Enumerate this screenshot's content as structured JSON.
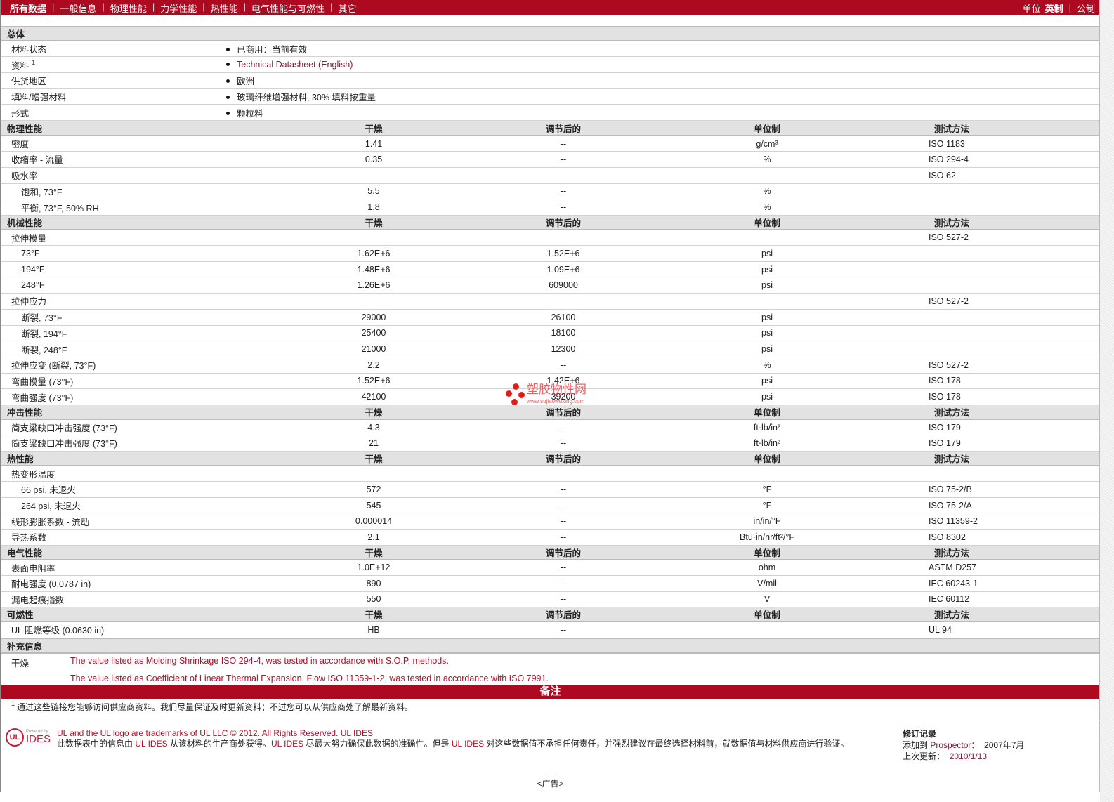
{
  "nav": {
    "active": "所有数据",
    "links": [
      "一般信息",
      "物理性能",
      "力学性能",
      "热性能",
      "电气性能与可燃性",
      "其它"
    ],
    "units_label": "单位",
    "unit_active": "英制",
    "unit_other": "公制"
  },
  "general": {
    "title": "总体",
    "rows": [
      {
        "label": "材料状态",
        "value": "已商用：当前有效"
      },
      {
        "label": "资料",
        "sup": "1",
        "value": "Technical Datasheet (English)",
        "link": true
      },
      {
        "label": "供货地区",
        "value": "欧洲"
      },
      {
        "label": "填料/增强材料",
        "value": "玻璃纤维增强材料, 30% 填料按重量"
      },
      {
        "label": "形式",
        "value": "颗粒料"
      }
    ]
  },
  "columns": {
    "dry": "干燥",
    "cond": "调节后的",
    "unit": "单位制",
    "method": "测试方法"
  },
  "sections": [
    {
      "title": "物理性能",
      "rows": [
        [
          "密度",
          0,
          "1.41",
          "--",
          "g/cm³",
          "ISO 1183"
        ],
        [
          "收缩率 - 流量",
          0,
          "0.35",
          "--",
          "%",
          "ISO 294-4"
        ],
        [
          "吸水率",
          0,
          "",
          "",
          "",
          "ISO 62"
        ],
        [
          "饱和, 73°F",
          1,
          "5.5",
          "--",
          "%",
          ""
        ],
        [
          "平衡, 73°F, 50% RH",
          1,
          "1.8",
          "--",
          "%",
          ""
        ]
      ]
    },
    {
      "title": "机械性能",
      "rows": [
        [
          "拉伸模量",
          0,
          "",
          "",
          "",
          "ISO 527-2"
        ],
        [
          "73°F",
          1,
          "1.62E+6",
          "1.52E+6",
          "psi",
          ""
        ],
        [
          "194°F",
          1,
          "1.48E+6",
          "1.09E+6",
          "psi",
          ""
        ],
        [
          "248°F",
          1,
          "1.26E+6",
          "609000",
          "psi",
          ""
        ],
        [
          "拉伸应力",
          0,
          "",
          "",
          "",
          "ISO 527-2"
        ],
        [
          "断裂, 73°F",
          1,
          "29000",
          "26100",
          "psi",
          ""
        ],
        [
          "断裂, 194°F",
          1,
          "25400",
          "18100",
          "psi",
          ""
        ],
        [
          "断裂, 248°F",
          1,
          "21000",
          "12300",
          "psi",
          ""
        ],
        [
          "拉伸应变 (断裂, 73°F)",
          0,
          "2.2",
          "--",
          "%",
          "ISO 527-2"
        ],
        [
          "弯曲模量 (73°F)",
          0,
          "1.52E+6",
          "1.42E+6",
          "psi",
          "ISO 178"
        ],
        [
          "弯曲强度 (73°F)",
          0,
          "42100",
          "39200",
          "psi",
          "ISO 178"
        ]
      ]
    },
    {
      "title": "冲击性能",
      "rows": [
        [
          "简支梁缺口冲击强度 (73°F)",
          0,
          "4.3",
          "--",
          "ft·lb/in²",
          "ISO 179"
        ],
        [
          "简支梁缺口冲击强度 (73°F)",
          0,
          "21",
          "--",
          "ft·lb/in²",
          "ISO 179"
        ]
      ]
    },
    {
      "title": "热性能",
      "rows": [
        [
          "热变形温度",
          0,
          "",
          "",
          "",
          ""
        ],
        [
          "66 psi, 未退火",
          1,
          "572",
          "--",
          "°F",
          "ISO 75-2/B"
        ],
        [
          "264 psi, 未退火",
          1,
          "545",
          "--",
          "°F",
          "ISO 75-2/A"
        ],
        [
          "线形膨胀系数 - 流动",
          0,
          "0.000014",
          "--",
          "in/in/°F",
          "ISO 11359-2"
        ],
        [
          "导热系数",
          0,
          "2.1",
          "--",
          "Btu·in/hr/ft²/°F",
          "ISO 8302"
        ]
      ]
    },
    {
      "title": "电气性能",
      "rows": [
        [
          "表面电阻率",
          0,
          "1.0E+12",
          "--",
          "ohm",
          "ASTM D257"
        ],
        [
          "耐电强度 (0.0787 in)",
          0,
          "890",
          "--",
          "V/mil",
          "IEC 60243-1"
        ],
        [
          "漏电起痕指数",
          0,
          "550",
          "--",
          "V",
          "IEC 60112"
        ]
      ]
    },
    {
      "title": "可燃性",
      "rows": [
        [
          "UL 阻燃等级 (0.0630 in)",
          0,
          "HB",
          "--",
          "",
          "UL 94"
        ]
      ]
    }
  ],
  "notes": {
    "title": "补充信息",
    "label": "干燥",
    "lines": [
      "The value listed as Molding Shrinkage ISO 294-4, was tested in accordance with S.O.P. methods.",
      "The value listed as Coefficient of Linear Thermal Expansion, Flow ISO 11359-1-2, was tested in accordance with ISO 7991."
    ]
  },
  "remarks": {
    "title": "备注",
    "sup": "1",
    "text": "通过这些链接您能够访问供应商资料。我们尽量保证及时更新资料；不过您可以从供应商处了解最新资料。"
  },
  "footer": {
    "logo_ul": "UL",
    "logo_powered": "Powered by",
    "logo_ides": "IDES",
    "trademark": "UL and the UL logo are trademarks of UL LLC © 2012. All Rights Reserved.",
    "trademark_link": "UL IDES",
    "disclaimer_a": "此数据表中的信息由 ",
    "ul_ides": "UL IDES",
    "disclaimer_b": " 从该材料的生产商处获得。",
    "disclaimer_c": " 尽最大努力确保此数据的准确性。但是 ",
    "disclaimer_d": " 对这些数据值不承担任何责任，并强烈建议在最终选择材料前，就数据值与材料供应商进行验证。",
    "rev_title": "修订记录",
    "rev_added_label": "添加到",
    "rev_added_link": "Prospector：",
    "rev_added_value": "2007年7月",
    "rev_updated_label": "上次更新：",
    "rev_updated_value": "2010/1/13",
    "ad": "<广告>"
  },
  "watermark": {
    "text": "塑胶物性网",
    "url": "www.sujiaowuxing.com"
  }
}
